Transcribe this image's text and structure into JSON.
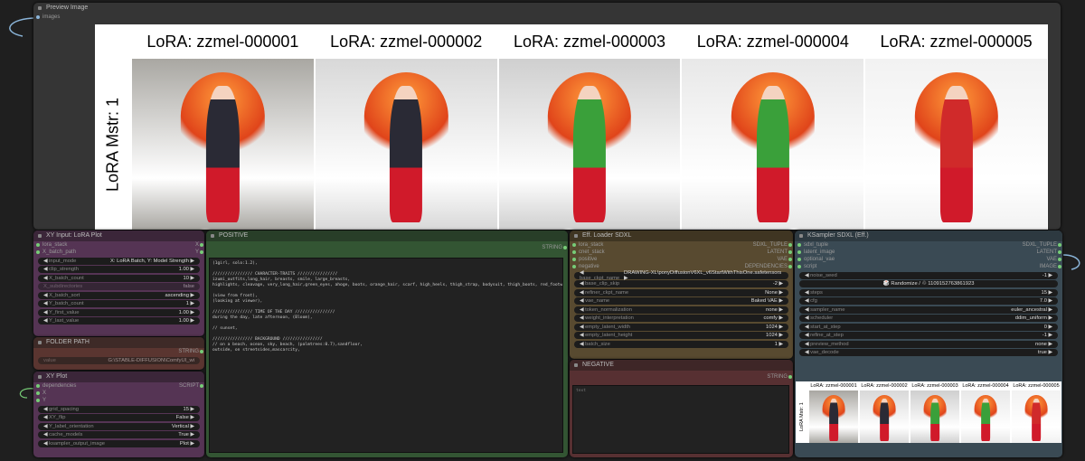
{
  "preview": {
    "title": "Preview Image",
    "input": "images",
    "row_label": "LoRA Mstr: 1",
    "columns": [
      "LoRA: zzmel-000001",
      "LoRA: zzmel-000002",
      "LoRA: zzmel-000003",
      "LoRA: zzmel-000004",
      "LoRA: zzmel-000005"
    ],
    "suits": [
      "#2a2a35",
      "#2a2a35",
      "#3aa03a",
      "#3aa03a",
      "#d02a2a"
    ],
    "bgs": [
      "#a9a7a2",
      "#d8d8d8",
      "#cfcfcf",
      "#e8e8e8",
      "#f2f2f2"
    ]
  },
  "xy_input": {
    "title": "XY Input: LoRA Plot",
    "inputs": [
      {
        "name": "lora_stack",
        "out": "X"
      },
      {
        "name": "X_batch_path",
        "out": "Y"
      }
    ],
    "widgets": [
      {
        "n": "input_mode",
        "v": "X: LoRA Batch, Y: Model Strength"
      },
      {
        "n": "clip_strength",
        "v": "1.00"
      },
      {
        "n": "X_batch_count",
        "v": "10"
      },
      {
        "n": "X_subdirectories",
        "v": "false",
        "dis": true
      },
      {
        "n": "X_batch_sort",
        "v": "ascending"
      },
      {
        "n": "Y_batch_count",
        "v": "1"
      },
      {
        "n": "Y_first_value",
        "v": "1.00"
      },
      {
        "n": "Y_last_value",
        "v": "1.00"
      }
    ]
  },
  "folder": {
    "title": "FOLDER PATH",
    "out": "STRING",
    "widgets": [
      {
        "n": "value",
        "v": "G:\\STABLE-DIFFUSION\\ComfyUI_wi",
        "dis": true
      }
    ]
  },
  "xy_plot": {
    "title": "XY Plot",
    "inputs": [
      {
        "name": "dependencies",
        "out": "SCRIPT"
      },
      {
        "name": "X",
        "out": ""
      },
      {
        "name": "Y",
        "out": ""
      }
    ],
    "widgets": [
      {
        "n": "grid_spacing",
        "v": "15"
      },
      {
        "n": "XY_flip",
        "v": "False"
      },
      {
        "n": "Y_label_orientation",
        "v": "Vertical"
      },
      {
        "n": "cache_models",
        "v": "True"
      },
      {
        "n": "ksampler_output_image",
        "v": "Plot"
      }
    ]
  },
  "positive": {
    "title": "POSITIVE",
    "out": "STRING",
    "text": "(1girl, solo:1.2),\n\n//////////////// CHARACTER-TRAITS ////////////////\nizumi_outfits,long_hair, breasts, smile, large_breasts,\nhighlights, cleavage, very_long_hair,green_eyes, ahoge, boots, orange_hair, scarf, high_heels, thigh_strap, bodysuit, thigh_boots, red_footwear, high_heel_boots,\n\n(view from front),\n(looking at viewer),\n\n//////////////// TIME OF THE DAY ////////////////\nduring the day, late afternoon, (Bloom),\n\n// sunset,\n\n//////////////// BACKGROUND ////////////////\n// on a beach, ocean, sky, beach, (palmtrees:0.7),sandfloor,\noutside, on streetsides,mascarcity,"
  },
  "eff_loader": {
    "title": "Eff. Loader SDXL",
    "inputs": [
      {
        "name": "lora_stack",
        "out": "SDXL_TUPLE"
      },
      {
        "name": "cnet_stack",
        "out": "LATENT"
      },
      {
        "name": "positive",
        "out": "VAE"
      },
      {
        "name": "negative",
        "out": "DEPENDENCIES"
      }
    ],
    "widgets": [
      {
        "n": "base_ckpt_name",
        "v": "DRAWING-XL\\ponyDiffusionV6XL_v6StartWithThisOne.safetensors"
      },
      {
        "n": "base_clip_skip",
        "v": "-2"
      },
      {
        "n": "refiner_ckpt_name",
        "v": "None"
      },
      {
        "n": "vae_name",
        "v": "Baked VAE"
      },
      {
        "n": "token_normalization",
        "v": "none"
      },
      {
        "n": "weight_interpretation",
        "v": "comfy"
      },
      {
        "n": "empty_latent_width",
        "v": "1024"
      },
      {
        "n": "empty_latent_height",
        "v": "1024"
      },
      {
        "n": "batch_size",
        "v": "1"
      }
    ]
  },
  "negative": {
    "title": "NEGATIVE",
    "out": "STRING",
    "text": "text"
  },
  "ksampler": {
    "title": "KSampler SDXL (Eff.)",
    "inputs": [
      {
        "name": "sdxl_tuple",
        "out": "SDXL_TUPLE"
      },
      {
        "name": "latent_image",
        "out": "LATENT"
      },
      {
        "name": "optional_vae",
        "out": "VAE"
      },
      {
        "name": "script",
        "out": "IMAGE"
      }
    ],
    "widgets": [
      {
        "n": "noise_seed",
        "v": "-1"
      },
      {
        "center": "🎲 Randomize / ♲ 1109152763861923"
      },
      {
        "n": "steps",
        "v": "15"
      },
      {
        "n": "cfg",
        "v": "7.0"
      },
      {
        "n": "sampler_name",
        "v": "euler_ancestral"
      },
      {
        "n": "scheduler",
        "v": "ddim_uniform"
      },
      {
        "n": "start_at_step",
        "v": "0"
      },
      {
        "n": "refine_at_step",
        "v": "-1"
      },
      {
        "n": "preview_method",
        "v": "none"
      },
      {
        "n": "vae_decode",
        "v": "true"
      }
    ]
  }
}
